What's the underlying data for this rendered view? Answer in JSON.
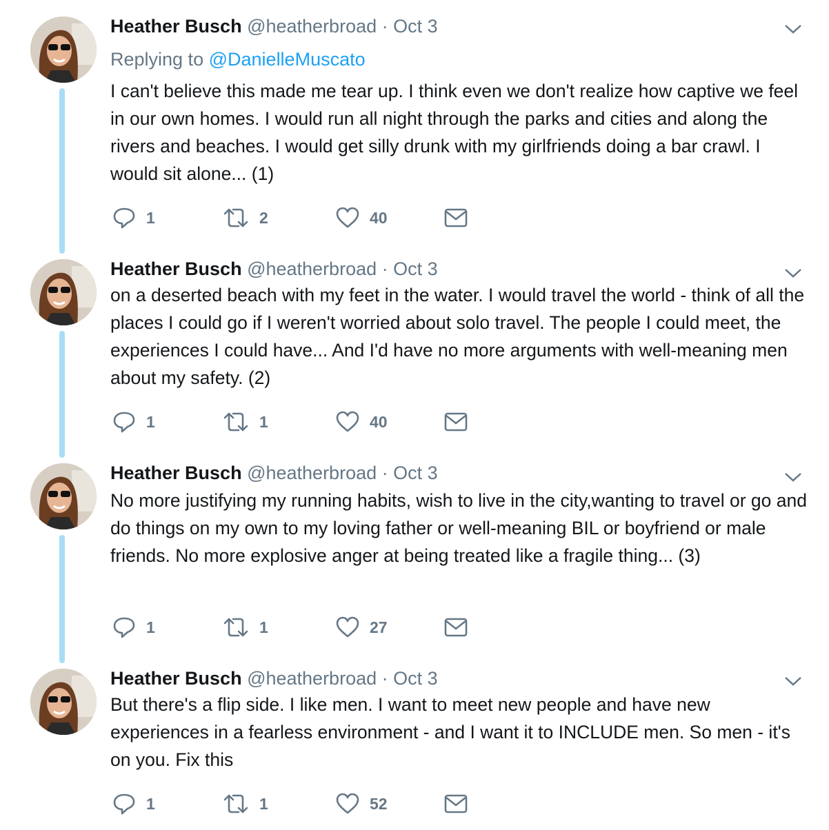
{
  "colors": {
    "accent": "#1da1f2",
    "muted": "#657786",
    "thread_line": "#a9dcf5",
    "text": "#14171a"
  },
  "icons": {
    "reply": "reply-icon",
    "retweet": "retweet-icon",
    "like": "heart-icon",
    "dm": "envelope-icon",
    "more": "chevron-down-icon"
  },
  "tweets": [
    {
      "name": "Heather Busch",
      "handle": "@heatherbroad",
      "separator": "·",
      "date": "Oct 3",
      "replying_prefix": "Replying to",
      "replying_to": "@DanielleMuscato",
      "text": "I can't believe this made me tear up. I think even we don't realize how captive we feel in our own homes. I would run all night through the parks and cities and along the rivers and beaches. I would get silly drunk with my girlfriends doing a bar crawl. I would sit alone... (1)",
      "replies": "1",
      "retweets": "2",
      "likes": "40"
    },
    {
      "name": "Heather Busch",
      "handle": "@heatherbroad",
      "separator": "·",
      "date": "Oct 3",
      "text": "on a deserted beach with my feet in the water. I would travel the world - think of all the places I could go if I weren't worried about solo travel. The people I could meet, the experiences I could have... And I'd have no more arguments with well-meaning men about my safety. (2)",
      "replies": "1",
      "retweets": "1",
      "likes": "40"
    },
    {
      "name": "Heather Busch",
      "handle": "@heatherbroad",
      "separator": "·",
      "date": "Oct 3",
      "text": "No more justifying my running habits, wish to live in the city,wanting to travel or go and do things on my own to my loving father or well-meaning BIL or boyfriend or male friends. No more explosive anger at being treated like a fragile thing... (3)",
      "replies": "1",
      "retweets": "1",
      "likes": "27"
    },
    {
      "name": "Heather Busch",
      "handle": "@heatherbroad",
      "separator": "·",
      "date": "Oct 3",
      "text": "But there's a flip side. I like men. I want to meet new people and have new experiences in a fearless environment - and I want it to INCLUDE men. So men - it's on you. Fix this",
      "replies": "1",
      "retweets": "1",
      "likes": "52"
    }
  ]
}
